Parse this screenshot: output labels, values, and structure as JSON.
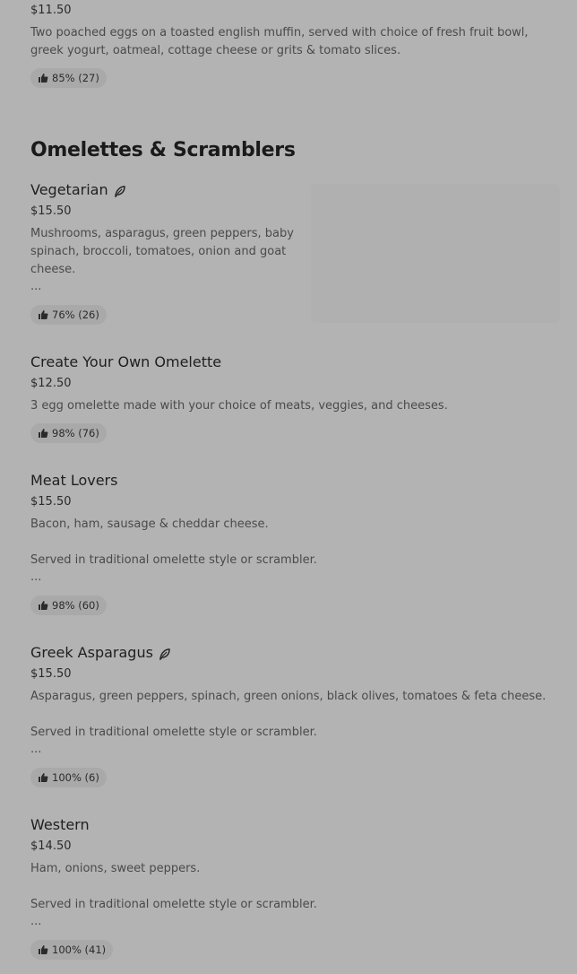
{
  "top_item": {
    "price": "$11.50",
    "desc": "Two poached eggs on a toasted english muffin, served with choice of fresh fruit bowl, greek yogurt, oatmeal, cottage cheese or grits & tomato slices.",
    "rating": "85% (27)"
  },
  "section": {
    "title": "Omelettes & Scramblers"
  },
  "items": [
    {
      "name": "Vegetarian",
      "price": "$15.50",
      "desc_lines": [
        "Mushrooms, asparagus, green peppers, baby",
        "spinach, broccoli, tomatoes, onion and goat",
        "cheese."
      ],
      "ellipsis": "...",
      "rating": "76% (26)"
    },
    {
      "name": "Create Your Own Omelette",
      "price": "$12.50",
      "desc": "3 egg omelette made with your choice of meats, veggies, and cheeses.",
      "rating": "98% (76)"
    },
    {
      "name": "Meat Lovers",
      "price": "$15.50",
      "desc": "Bacon, ham, sausage & cheddar cheese.",
      "desc2": "Served in traditional omelette style or scrambler.",
      "ellipsis": "...",
      "rating": "98% (60)"
    },
    {
      "name": "Greek Asparagus",
      "price": "$15.50",
      "desc": "Asparagus, green peppers, spinach, green onions, black olives, tomatoes & feta cheese.",
      "desc2": "Served in traditional omelette style or scrambler.",
      "ellipsis": "...",
      "rating": "100% (6)"
    },
    {
      "name": "Western",
      "price": "$14.50",
      "desc": "Ham, onions, sweet peppers.",
      "desc2": "Served in traditional omelette style or scrambler.",
      "ellipsis": "...",
      "rating": "100% (41)"
    }
  ],
  "icons": {
    "rating": "thumbs-up-icon",
    "vegetarian": "leaf-icon"
  }
}
